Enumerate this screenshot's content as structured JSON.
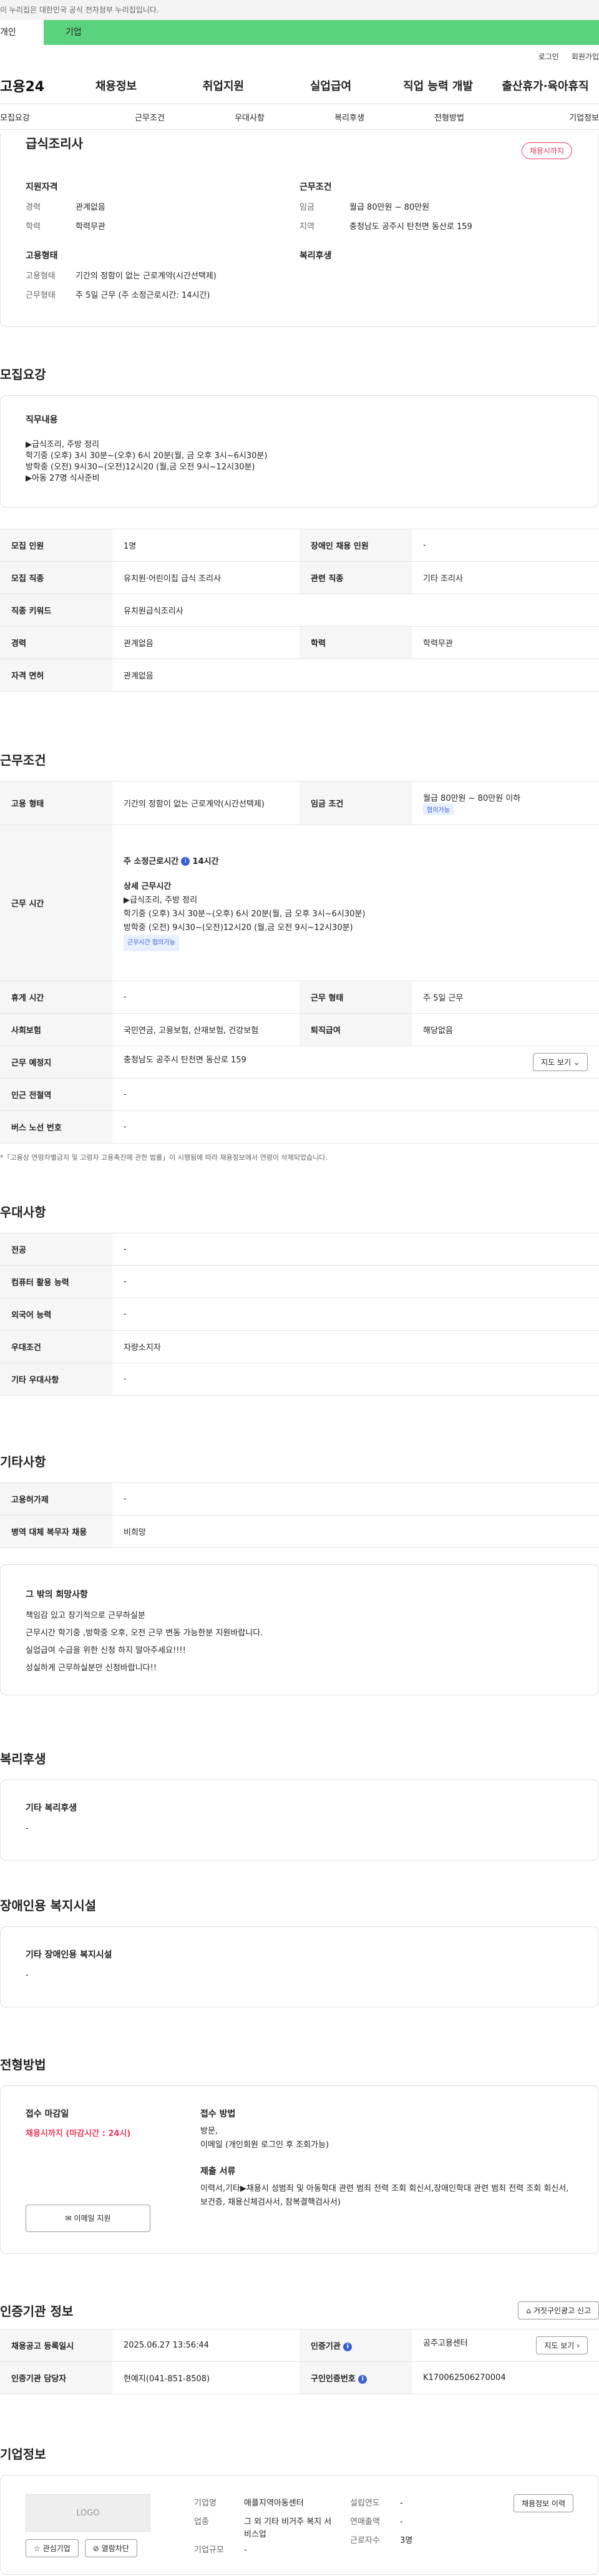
{
  "banner": {
    "text": "이 누리집은 대한민국 공식 전자정부 누리집입니다."
  },
  "seg": {
    "a": "개인",
    "b": "기업"
  },
  "util": {
    "login": "로그인",
    "join": "회원가입"
  },
  "gnb": {
    "logo": "고용24",
    "items": [
      "채용정보",
      "취업지원",
      "실업급여",
      "직업 능력 개발",
      "출산휴가·육아휴직"
    ]
  },
  "tabs": [
    "모집요강",
    "근무조건",
    "우대사항",
    "복리후생",
    "전형방법",
    "기업정보"
  ],
  "job": {
    "title": "급식조리사",
    "status": "채용시까지"
  },
  "summary": {
    "qual_h": "지원자격",
    "cond_h": "근무조건",
    "emp_h": "고용형태",
    "wel_h": "복리후생",
    "career_k": "경력",
    "career_v": "관계없음",
    "edu_k": "학력",
    "edu_v": "학력무관",
    "wage_k": "임금",
    "wage_v": "월급 80만원 ~ 80만원",
    "area_k": "지역",
    "area_v": "충청남도 공주시 탄천면 동산로 159",
    "emptype_k": "고용형태",
    "emptype_v": "기간의 정함이 없는 근로계약(시간선택제)",
    "worktype_k": "근무형태",
    "worktype_v": "주 5일 근무 (주 소정근로시간: 14시간)"
  },
  "recruit": {
    "heading": "모집요강",
    "duty_h": "직무내용",
    "duty": [
      "▶급식조리, 주방 정리",
      "학기중 (오후) 3시 30분~(오후) 6시 20분(월, 금 오후 3시~6시30분)",
      "방학중 (오전) 9시30~(오전)12시20 (월,금 오전 9시~12시30분)",
      "▶아동 27명 식사준비"
    ],
    "rows": [
      [
        "모집 인원",
        "1명",
        "장애인 채용 인원",
        "-"
      ],
      [
        "모집 직종",
        "유치원·어린이집 급식 조리사",
        "관련 직종",
        "기타 조리사"
      ],
      [
        "직종 키워드",
        "유치원급식조리사",
        "",
        ""
      ],
      [
        "경력",
        "관계없음",
        "학력",
        "학력무관"
      ],
      [
        "자격 면허",
        "관계없음",
        "",
        ""
      ]
    ]
  },
  "cond": {
    "heading": "근무조건",
    "emp_h": "고용 형태",
    "emp_v": "기간의 정함이 없는 근로계약(시간선택제)",
    "wage_h": "임금 조건",
    "wage_v": "월급 80만원 ~ 80만원 이하",
    "wage_tag": "협의가능",
    "time_h": "근무 시간",
    "time_total": "주 소정근로시간",
    "time_total_v": "14시간",
    "detail_h": "상세 근무시간",
    "detail": [
      "▶급식조리, 주방 정리",
      "학기중 (오후) 3시 30분~(오후) 6시 20분(월, 금 오후 3시~6시30분)",
      "방학중 (오전) 9시30~(오전)12시20 (월,금 오전 9시~12시30분)"
    ],
    "time_tag": "근무시간 협의가능",
    "rest_h": "휴게 시간",
    "rest_v": "-",
    "worktype_h": "근무 형태",
    "worktype_v": "주 5일 근무",
    "ins_h": "사회보험",
    "ins_v": "국민연금, 고용보험, 산재보험, 건강보험",
    "sev_h": "퇴직급여",
    "sev_v": "해당없음",
    "place_h": "근무 예정지",
    "place_v": "충청남도 공주시 탄천면 동산로 159",
    "map_btn": "지도 보기",
    "subway_h": "인근 전철역",
    "subway_v": "-",
    "bus_h": "버스 노선 번호",
    "bus_v": "-",
    "note": "*「고용상 연령차별금지 및 고령자 고용촉진에 관한 법률」이 시행됨에 따라 채용정보에서 연령이 삭제되었습니다."
  },
  "pref": {
    "heading": "우대사항",
    "rows": [
      [
        "전공",
        "-"
      ],
      [
        "컴퓨터 활용 능력",
        "-"
      ],
      [
        "외국어 능력",
        "-"
      ],
      [
        "우대조건",
        "자량소지자"
      ],
      [
        "기타 우대사항",
        "-"
      ]
    ]
  },
  "etc": {
    "heading": "기타사항",
    "rows": [
      [
        "고용허가제",
        "-"
      ],
      [
        "병역 대체 복무자 채용",
        "비희망"
      ]
    ],
    "hope_h": "그 밖의 희망사항",
    "hope": [
      "책임감 있고 장기적으로 근무하실분",
      "근무시간 학기중 ,방학중 오후, 오전 근무 변동 가능한분 지원바랍니다.",
      "실업급여 수급을 위한 신청 하지 말아주세요!!!!",
      "성실하게 근무하실분만 신청바랍니다!!"
    ]
  },
  "welfare": {
    "heading": "복리후생",
    "sub": "기타 복리후생",
    "val": "-"
  },
  "disab": {
    "heading": "장애인용 복지시설",
    "sub": "기타 장애인용 복지시설",
    "val": "-"
  },
  "process": {
    "heading": "전형방법",
    "deadline_h": "접수 마감일",
    "deadline_v": "채용시까지 (마감시간 : 24시)",
    "method_h": "접수 방법",
    "method_v": [
      "방문,",
      "이메일 (개인회원 로그인 후 조회가능)"
    ],
    "doc_h": "제출 서류",
    "doc_v": "이력서,기타▶채용시 성범죄 및 아동학대 관련 범죄 전력 조회 회신서,장애인학대 관련 범죄 전력 조회 회신서, 보건증, 채용신체검사서, 참복결핵검사서)",
    "email_btn": "이메일 지원"
  },
  "cert": {
    "heading": "인증기관 정보",
    "report_btn": "거짓구인광고 신고",
    "reg_h": "채용공고 등록일시",
    "reg_v": "2025.06.27 13:56:44",
    "org_h": "인증기관",
    "org_v": "공주고용센터",
    "map_btn": "지도 보기",
    "mgr_h": "인증기관 담당자",
    "mgr_v": "현예지(041-851-8508)",
    "no_h": "구인인증번호",
    "no_v": "K170062506270004"
  },
  "company": {
    "heading": "기업정보",
    "logo": "LOGO",
    "fav_btn": "관심기업",
    "block_btn": "열람차단",
    "recruit_btn": "채용정보 이력",
    "name_k": "기업명",
    "name_v": "애플지역아동센터",
    "ind_k": "업종",
    "ind_v": "그 외 기타 비거주 복지 서비스업",
    "scale_k": "기업규모",
    "scale_v": "-",
    "year_k": "설립연도",
    "year_v": "-",
    "sales_k": "연매출액",
    "sales_v": "-",
    "emp_k": "근로자수",
    "emp_v": "3명"
  }
}
